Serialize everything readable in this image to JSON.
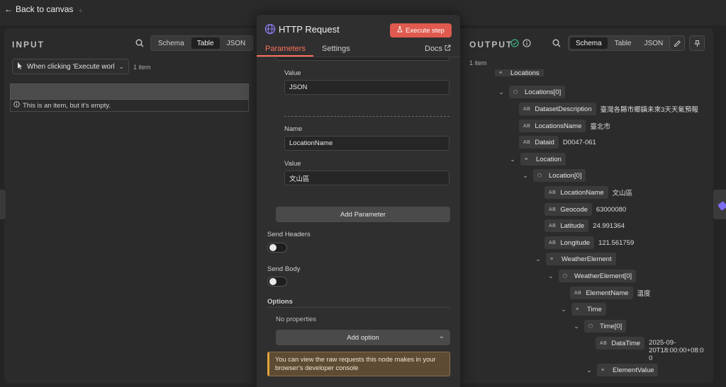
{
  "topbar": {
    "back_label": "Back to canvas"
  },
  "input": {
    "title": "INPUT",
    "view_options": [
      "Schema",
      "Table",
      "JSON"
    ],
    "active_view": "Table",
    "trigger_label": "When clicking 'Execute workfl",
    "item_count": "1 item",
    "empty_message": "This is an item, but it's empty."
  },
  "node": {
    "title": "HTTP Request",
    "execute_label": "Execute step",
    "tabs": [
      "Parameters",
      "Settings"
    ],
    "docs_label": "Docs",
    "params": {
      "value_label_1": "Value",
      "value_1": "JSON",
      "name_label": "Name",
      "name_value": "LocationName",
      "value_label_2": "Value",
      "value_2": "文山區"
    },
    "add_parameter_label": "Add Parameter",
    "send_headers_label": "Send Headers",
    "send_body_label": "Send Body",
    "options_label": "Options",
    "no_properties_label": "No properties",
    "add_option_label": "Add option",
    "notice_text": "You can view the raw requests this node makes in your browser's developer console"
  },
  "output": {
    "title": "OUTPUT",
    "view_options": [
      "Schema",
      "Table",
      "JSON"
    ],
    "active_view": "Schema",
    "item_count": "1 item",
    "tree": {
      "locations_partial": "Locations",
      "locations0": "Locations[0]",
      "dataset_desc_key": "DatasetDescription",
      "dataset_desc_val": "臺灣各縣市鄉鎮未來3天天氣預報",
      "locations_name_key": "LocationsName",
      "locations_name_val": "臺北市",
      "dataid_key": "Dataid",
      "dataid_val": "D0047-061",
      "location_key": "Location",
      "location0": "Location[0]",
      "location_name_key": "LocationName",
      "location_name_val": "文山區",
      "geocode_key": "Geocode",
      "geocode_val": "63000080",
      "latitude_key": "Latitude",
      "latitude_val": "24.991364",
      "longitude_key": "Longitude",
      "longitude_val": "121.561759",
      "weather_element_key": "WeatherElement",
      "weather_element0": "WeatherElement[0]",
      "element_name_key": "ElementName",
      "element_name_val": "溫度",
      "time_key": "Time",
      "time0": "Time[0]",
      "datetime_key": "DataTime",
      "datetime_val_line1": "2025-09-",
      "datetime_val_line2": "20T18:00:00+08:0",
      "datetime_val_line3": "0",
      "element_value_key": "ElementValue"
    },
    "type_badges": {
      "string": "AB",
      "list": "≡",
      "object": "⬡"
    }
  }
}
